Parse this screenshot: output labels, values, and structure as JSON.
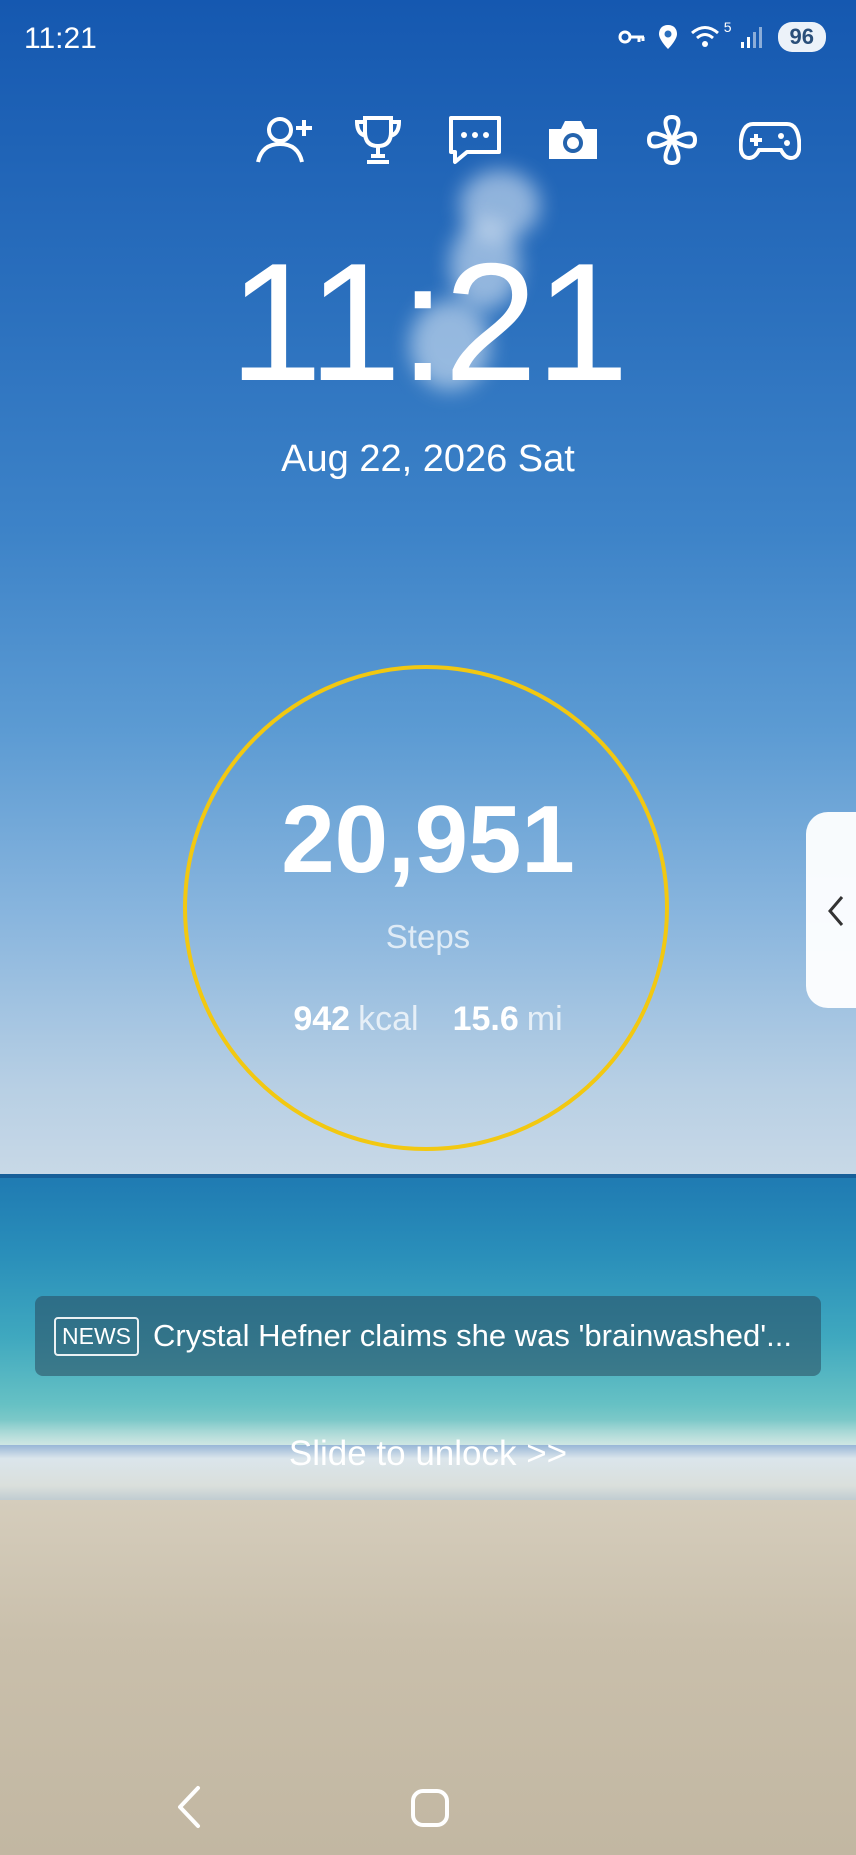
{
  "status_bar": {
    "time": "11:21",
    "wifi_superscript": "5",
    "battery": "96",
    "icons": [
      "key-icon",
      "location-icon",
      "wifi-icon",
      "signal-icon",
      "battery-icon"
    ]
  },
  "toolbar": {
    "icons": [
      "add-contact-icon",
      "trophy-icon",
      "message-icon",
      "camera-icon",
      "clover-icon",
      "gamepad-icon"
    ]
  },
  "clock": {
    "time": "11:21",
    "date": "Aug 22, 2026 Sat"
  },
  "pedometer": {
    "steps": "20,951",
    "steps_label": "Steps",
    "kcal_value": "942",
    "kcal_unit": "kcal",
    "distance_value": "15.6",
    "distance_unit": "mi",
    "ring_color": "#f2c811"
  },
  "news": {
    "badge": "NEWS",
    "headline": "Crystal Hefner claims she was 'brainwashed'..."
  },
  "unlock": {
    "label": "Slide to unlock >>"
  },
  "navigation": {
    "icons": [
      "back-icon",
      "home-icon"
    ]
  }
}
